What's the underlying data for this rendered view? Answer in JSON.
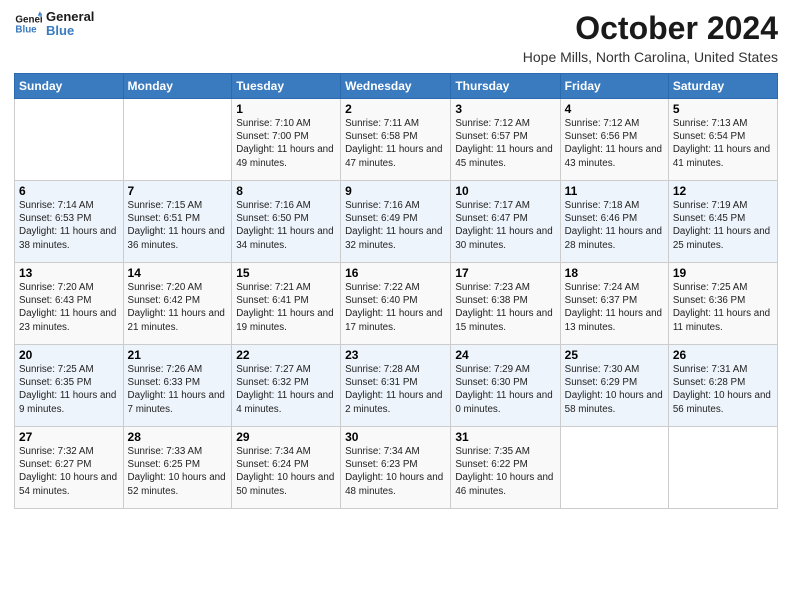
{
  "header": {
    "logo_line1": "General",
    "logo_line2": "Blue",
    "month": "October 2024",
    "location": "Hope Mills, North Carolina, United States"
  },
  "weekdays": [
    "Sunday",
    "Monday",
    "Tuesday",
    "Wednesday",
    "Thursday",
    "Friday",
    "Saturday"
  ],
  "weeks": [
    [
      {
        "day": "",
        "info": ""
      },
      {
        "day": "",
        "info": ""
      },
      {
        "day": "1",
        "info": "Sunrise: 7:10 AM\nSunset: 7:00 PM\nDaylight: 11 hours and 49 minutes."
      },
      {
        "day": "2",
        "info": "Sunrise: 7:11 AM\nSunset: 6:58 PM\nDaylight: 11 hours and 47 minutes."
      },
      {
        "day": "3",
        "info": "Sunrise: 7:12 AM\nSunset: 6:57 PM\nDaylight: 11 hours and 45 minutes."
      },
      {
        "day": "4",
        "info": "Sunrise: 7:12 AM\nSunset: 6:56 PM\nDaylight: 11 hours and 43 minutes."
      },
      {
        "day": "5",
        "info": "Sunrise: 7:13 AM\nSunset: 6:54 PM\nDaylight: 11 hours and 41 minutes."
      }
    ],
    [
      {
        "day": "6",
        "info": "Sunrise: 7:14 AM\nSunset: 6:53 PM\nDaylight: 11 hours and 38 minutes."
      },
      {
        "day": "7",
        "info": "Sunrise: 7:15 AM\nSunset: 6:51 PM\nDaylight: 11 hours and 36 minutes."
      },
      {
        "day": "8",
        "info": "Sunrise: 7:16 AM\nSunset: 6:50 PM\nDaylight: 11 hours and 34 minutes."
      },
      {
        "day": "9",
        "info": "Sunrise: 7:16 AM\nSunset: 6:49 PM\nDaylight: 11 hours and 32 minutes."
      },
      {
        "day": "10",
        "info": "Sunrise: 7:17 AM\nSunset: 6:47 PM\nDaylight: 11 hours and 30 minutes."
      },
      {
        "day": "11",
        "info": "Sunrise: 7:18 AM\nSunset: 6:46 PM\nDaylight: 11 hours and 28 minutes."
      },
      {
        "day": "12",
        "info": "Sunrise: 7:19 AM\nSunset: 6:45 PM\nDaylight: 11 hours and 25 minutes."
      }
    ],
    [
      {
        "day": "13",
        "info": "Sunrise: 7:20 AM\nSunset: 6:43 PM\nDaylight: 11 hours and 23 minutes."
      },
      {
        "day": "14",
        "info": "Sunrise: 7:20 AM\nSunset: 6:42 PM\nDaylight: 11 hours and 21 minutes."
      },
      {
        "day": "15",
        "info": "Sunrise: 7:21 AM\nSunset: 6:41 PM\nDaylight: 11 hours and 19 minutes."
      },
      {
        "day": "16",
        "info": "Sunrise: 7:22 AM\nSunset: 6:40 PM\nDaylight: 11 hours and 17 minutes."
      },
      {
        "day": "17",
        "info": "Sunrise: 7:23 AM\nSunset: 6:38 PM\nDaylight: 11 hours and 15 minutes."
      },
      {
        "day": "18",
        "info": "Sunrise: 7:24 AM\nSunset: 6:37 PM\nDaylight: 11 hours and 13 minutes."
      },
      {
        "day": "19",
        "info": "Sunrise: 7:25 AM\nSunset: 6:36 PM\nDaylight: 11 hours and 11 minutes."
      }
    ],
    [
      {
        "day": "20",
        "info": "Sunrise: 7:25 AM\nSunset: 6:35 PM\nDaylight: 11 hours and 9 minutes."
      },
      {
        "day": "21",
        "info": "Sunrise: 7:26 AM\nSunset: 6:33 PM\nDaylight: 11 hours and 7 minutes."
      },
      {
        "day": "22",
        "info": "Sunrise: 7:27 AM\nSunset: 6:32 PM\nDaylight: 11 hours and 4 minutes."
      },
      {
        "day": "23",
        "info": "Sunrise: 7:28 AM\nSunset: 6:31 PM\nDaylight: 11 hours and 2 minutes."
      },
      {
        "day": "24",
        "info": "Sunrise: 7:29 AM\nSunset: 6:30 PM\nDaylight: 11 hours and 0 minutes."
      },
      {
        "day": "25",
        "info": "Sunrise: 7:30 AM\nSunset: 6:29 PM\nDaylight: 10 hours and 58 minutes."
      },
      {
        "day": "26",
        "info": "Sunrise: 7:31 AM\nSunset: 6:28 PM\nDaylight: 10 hours and 56 minutes."
      }
    ],
    [
      {
        "day": "27",
        "info": "Sunrise: 7:32 AM\nSunset: 6:27 PM\nDaylight: 10 hours and 54 minutes."
      },
      {
        "day": "28",
        "info": "Sunrise: 7:33 AM\nSunset: 6:25 PM\nDaylight: 10 hours and 52 minutes."
      },
      {
        "day": "29",
        "info": "Sunrise: 7:34 AM\nSunset: 6:24 PM\nDaylight: 10 hours and 50 minutes."
      },
      {
        "day": "30",
        "info": "Sunrise: 7:34 AM\nSunset: 6:23 PM\nDaylight: 10 hours and 48 minutes."
      },
      {
        "day": "31",
        "info": "Sunrise: 7:35 AM\nSunset: 6:22 PM\nDaylight: 10 hours and 46 minutes."
      },
      {
        "day": "",
        "info": ""
      },
      {
        "day": "",
        "info": ""
      }
    ]
  ]
}
